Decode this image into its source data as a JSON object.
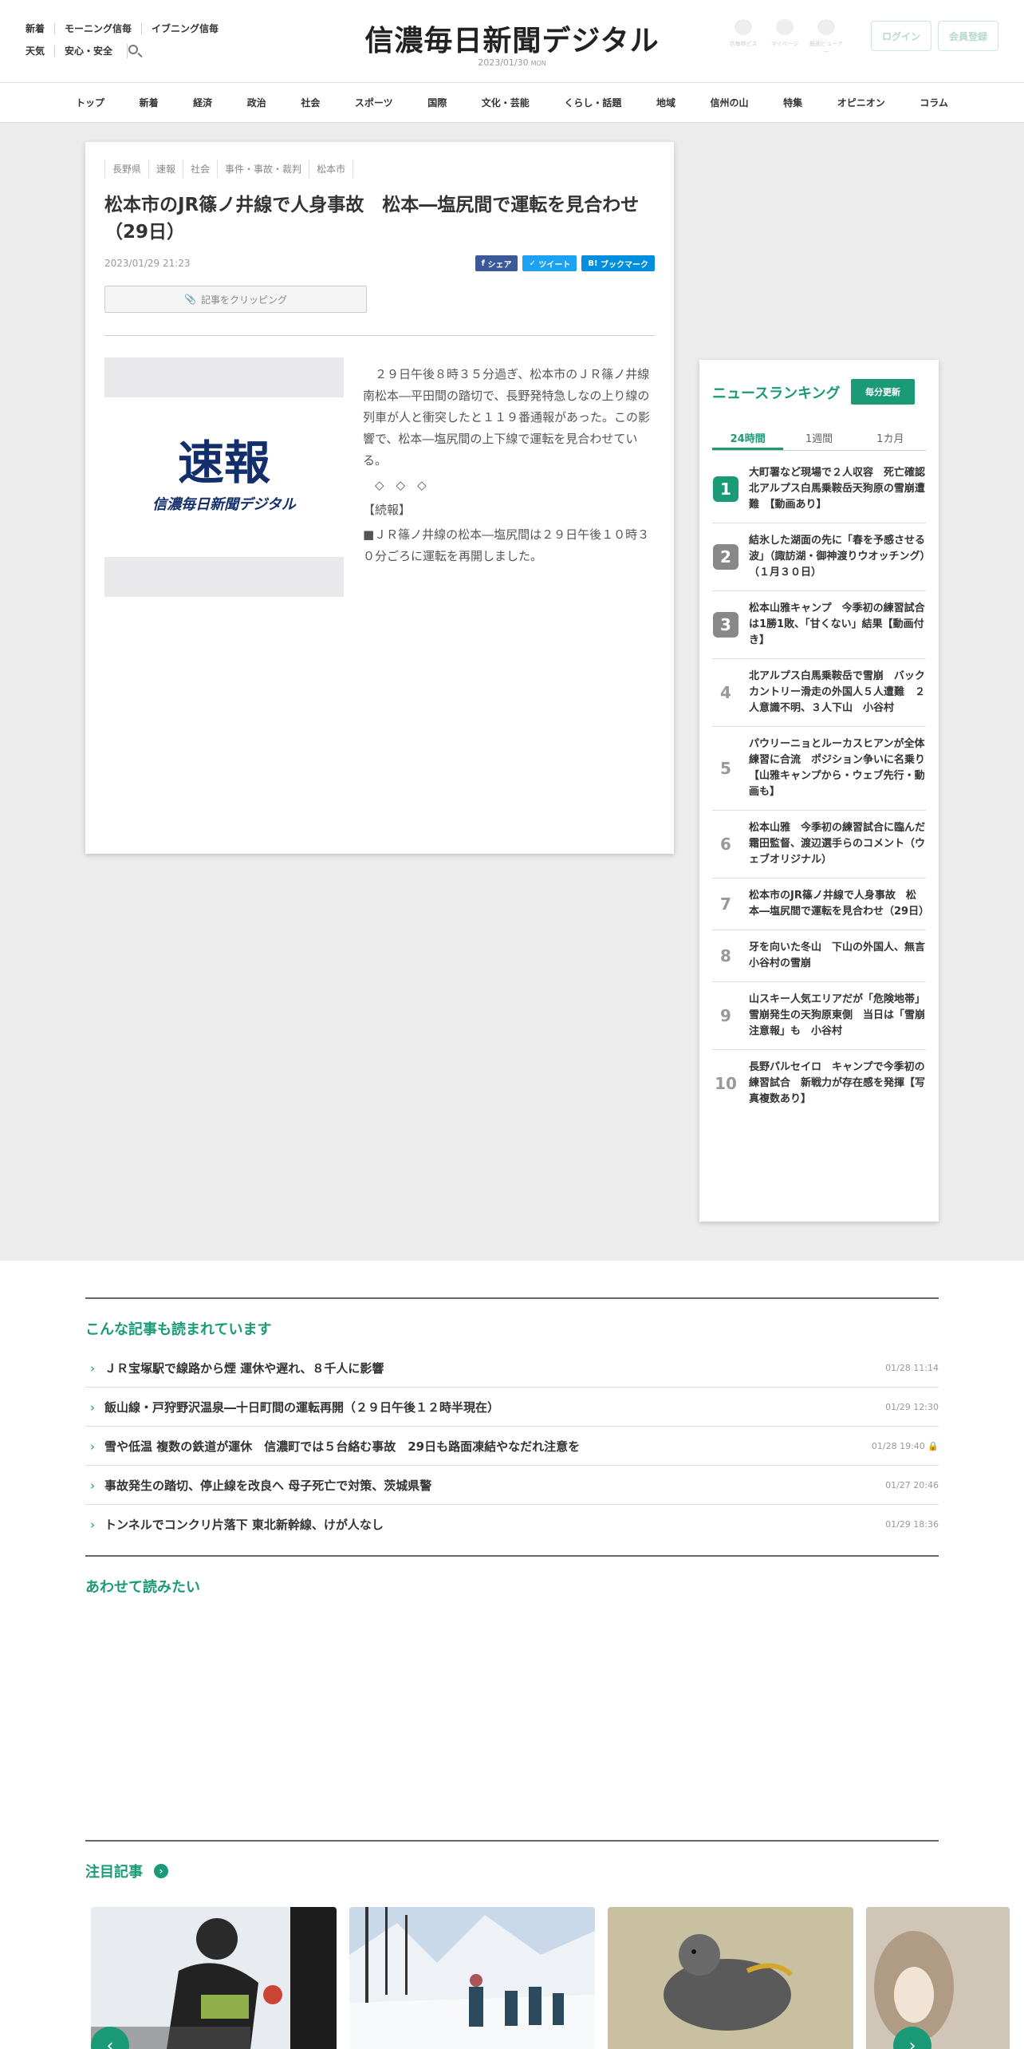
{
  "header": {
    "nav_links_row1": [
      "新着",
      "モーニング信毎",
      "イブニング信毎"
    ],
    "nav_links_row2": [
      "天気",
      "安心・安全"
    ],
    "logo": "信濃毎日新聞デジタル",
    "date": "2023/01/30",
    "weekday": "MON",
    "icons": [
      {
        "icon": "pin-icon",
        "label": "信毎特ピス"
      },
      {
        "icon": "user-icon",
        "label": "マイページ"
      },
      {
        "icon": "mail-icon",
        "label": "紙面ビューアー"
      }
    ],
    "login_label": "ログイン",
    "register_label": "会員登録"
  },
  "nav": [
    "トップ",
    "新着",
    "経済",
    "政治",
    "社会",
    "スポーツ",
    "国際",
    "文化・芸能",
    "くらし・話題",
    "地域",
    "信州の山",
    "特集",
    "オピニオン",
    "コラム"
  ],
  "article": {
    "tags": [
      "長野県",
      "速報",
      "社会",
      "事件・事故・裁判",
      "松本市"
    ],
    "title": "松本市のJR篠ノ井線で人身事故　松本―塩尻間で運転を見合わせ（29日）",
    "date": "2023/01/29 21:23",
    "share_labels": [
      "シェア",
      "ツイート",
      "ブックマーク"
    ],
    "clip_label": "記事をクリッピング",
    "image_text": "速報",
    "image_sub": "信濃毎日新聞デジタル",
    "paragraphs": [
      "　２９日午後８時３５分過ぎ、松本市のＪＲ篠ノ井線南松本―平田間の踏切で、長野発特急しなの上り線の列車が人と衝突したと１１９番通報があった。この影響で、松本―塩尻間の上下線で運転を見合わせている。",
      "　◇　◇　◇",
      "【続報】",
      "■ＪＲ篠ノ井線の松本―塩尻間は２９日午後１０時３０分ごろに運転を再開しました。"
    ]
  },
  "ranking": {
    "title": "ニュースランキング",
    "update_label": "毎分更新",
    "tabs": [
      "24時間",
      "1週間",
      "1カ月"
    ],
    "items": [
      {
        "rank": "1",
        "text": "大町署など現場で２人収容　死亡確認　北アルプス白馬乗鞍岳天狗原の雪崩遭難　【動画あり】"
      },
      {
        "rank": "2",
        "text": "結氷した湖面の先に「春を予感させる波」（諏訪湖・御神渡りウオッチング）（１月３０日）"
      },
      {
        "rank": "3",
        "text": "松本山雅キャンプ　今季初の練習試合は1勝1敗、「甘くない」結果【動画付き】"
      },
      {
        "rank": "4",
        "text": "北アルプス白馬乗鞍岳で雪崩　バックカントリー滑走の外国人５人遭難　２人意識不明、３人下山　小谷村"
      },
      {
        "rank": "5",
        "text": "パウリーニョとルーカスヒアンが全体練習に合流　ポジション争いに名乗り　【山雅キャンプから・ウェブ先行・動画も】"
      },
      {
        "rank": "6",
        "text": "松本山雅　今季初の練習試合に臨んだ霜田監督、渡辺選手らのコメント（ウェブオリジナル）"
      },
      {
        "rank": "7",
        "text": "松本市のJR篠ノ井線で人身事故　松本―塩尻間で運転を見合わせ（29日）"
      },
      {
        "rank": "8",
        "text": "牙を向いた冬山　下山の外国人、無言　小谷村の雪崩"
      },
      {
        "rank": "9",
        "text": "山スキー人気エリアだが「危険地帯」　雪崩発生の天狗原東側　当日は「雪崩注意報」も　小谷村"
      },
      {
        "rank": "10",
        "text": "長野パルセイロ　キャンプで今季初の練習試合　新戦力が存在感を発揮【写真複数あり】"
      }
    ]
  },
  "related": {
    "heading": "こんな記事も読まれています",
    "items": [
      {
        "title": "ＪＲ宝塚駅で線路から煙 運休や遅れ、８千人に影響",
        "date": "01/28 11:14"
      },
      {
        "title": "飯山線・戸狩野沢温泉―十日町間の運転再開（２９日午後１２時半現在）",
        "date": "01/29 12:30"
      },
      {
        "title": "雪や低温 複数の鉄道が運休　信濃町では５台絡む事故　29日も路面凍結やなだれ注意を",
        "date": "01/28 19:40"
      },
      {
        "title": "事故発生の踏切、停止線を改良へ 母子死亡で対策、茨城県警",
        "date": "01/27 20:46"
      },
      {
        "title": "トンネルでコンクリ片落下 東北新幹線、けが人なし",
        "date": "01/29 18:36"
      }
    ]
  },
  "also_read": {
    "heading": "あわせて読みたい"
  },
  "featured": {
    "heading": "注目記事"
  }
}
